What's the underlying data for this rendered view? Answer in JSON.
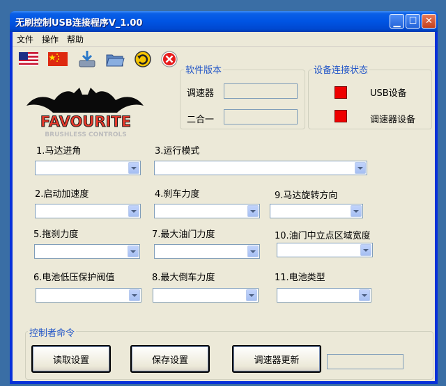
{
  "window": {
    "title": "无刷控制USB连接程序V_1.00"
  },
  "menu": {
    "items": [
      "文件",
      "操作",
      "帮助"
    ]
  },
  "logo": {
    "text_line1": "FAVOURITE",
    "text_line2": "BRUSHLESS CONTROLS"
  },
  "software_version": {
    "title": "软件版本",
    "esc_label": "调速器",
    "esc_value": "",
    "combo_label": "二合一",
    "combo_value": ""
  },
  "device_status": {
    "title": "设备连接状态",
    "usb_label": "USB设备",
    "esc_label": "调速器设备",
    "indicator_color": "#ee0000"
  },
  "settings": {
    "timing_label": "1.马达进角",
    "run_mode_label": "3.运行模式",
    "startup_accel_label": "2.启动加速度",
    "brake_force_label": "4.刹车力度",
    "motor_direction_label": "9.马达旋转方向",
    "drag_brake_label": "5.拖刹力度",
    "max_throttle_label": "7.最大油门力度",
    "neutral_range_label": "10.油门中立点区域宽度",
    "low_voltage_label": "6.电池低压保护阀值",
    "max_reverse_label": "8.最大倒车力度",
    "battery_type_label": "11.电池类型"
  },
  "commands": {
    "title": "控制者命令",
    "read_label": "读取设置",
    "save_label": "保存设置",
    "update_label": "调速器更新",
    "status_value": ""
  },
  "colors": {
    "group_title": "#2155c7",
    "title_bar": "#0054e3",
    "background": "#ece9d8"
  }
}
